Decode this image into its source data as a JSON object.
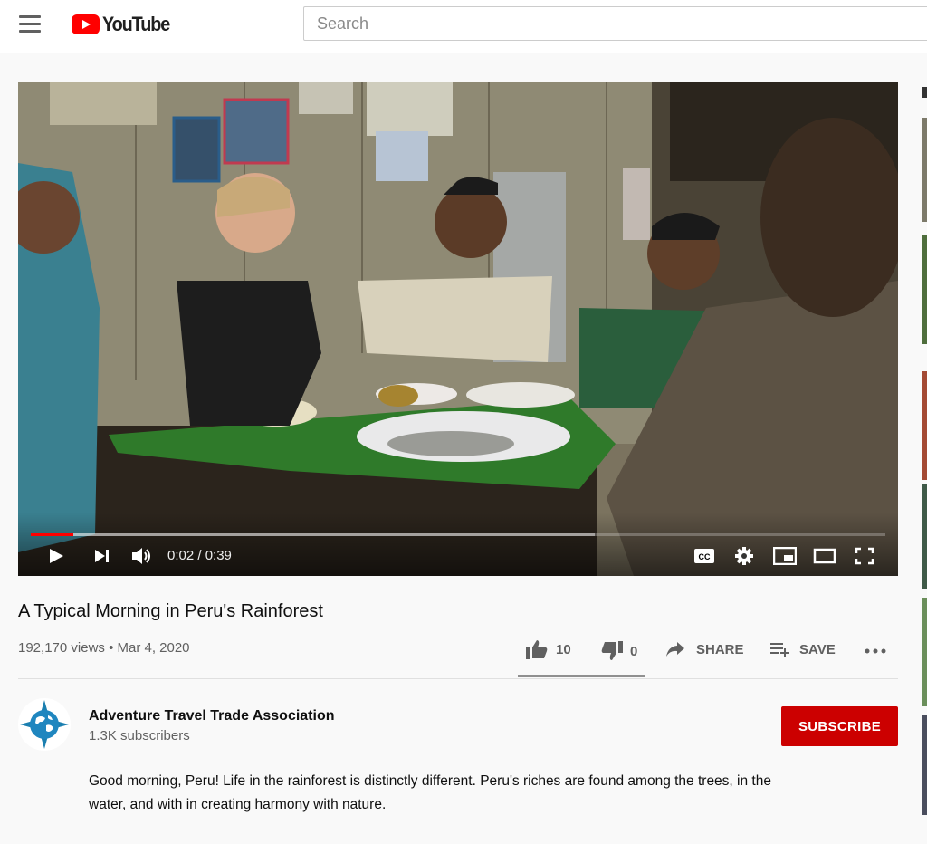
{
  "header": {
    "logo_text": "YouTube",
    "search_placeholder": "Search"
  },
  "player": {
    "current_time": "0:02",
    "duration": "0:39",
    "time_display": "0:02 / 0:39",
    "progress_fraction": 0.05
  },
  "video": {
    "title": "A Typical Morning in Peru's Rainforest",
    "meta": "192,170 views • Mar 4, 2020",
    "likes": "10",
    "dislikes": "0",
    "share_label": "SHARE",
    "save_label": "SAVE"
  },
  "channel": {
    "name": "Adventure Travel Trade Association",
    "subscribers": "1.3K subscribers",
    "subscribe_label": "SUBSCRIBE"
  },
  "description": "Good morning, Peru! Life in the rainforest is distinctly different. Peru's riches are found among the trees, in the water, and with in creating harmony with nature.",
  "colors": {
    "brand_red": "#ff0000",
    "subscribe_bg": "#cc0000",
    "meta_text": "#606060"
  },
  "icons": [
    "menu-icon",
    "youtube-logo-icon",
    "play-icon",
    "next-icon",
    "volume-icon",
    "captions-icon",
    "settings-icon",
    "miniplayer-icon",
    "theater-icon",
    "fullscreen-icon",
    "thumbs-up-icon",
    "thumbs-down-icon",
    "share-icon",
    "add-to-playlist-icon",
    "more-icon",
    "globe-compass-icon"
  ]
}
